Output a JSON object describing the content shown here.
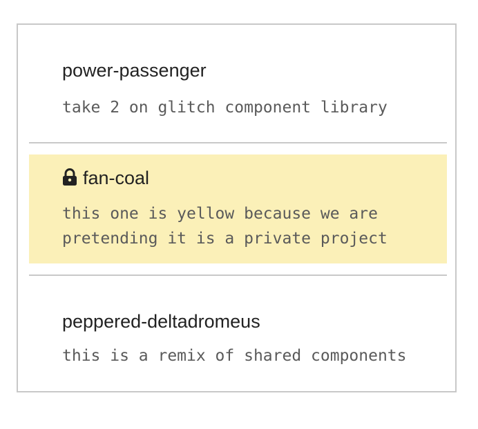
{
  "projects": [
    {
      "name": "power-passenger",
      "description": "take 2 on glitch component library",
      "private": false
    },
    {
      "name": "fan-coal",
      "description": "this one is yellow because we are\npretending it is a private project",
      "private": true,
      "icon": "lock-icon",
      "highlight_color": "#fbf0b8"
    },
    {
      "name": "peppered-deltadromeus",
      "description": "this is a remix of shared components",
      "private": false
    }
  ],
  "colors": {
    "border": "#c8c8c8",
    "title_text": "#222222",
    "description_text": "#5a5a5a",
    "private_background": "#fbf0b8"
  }
}
